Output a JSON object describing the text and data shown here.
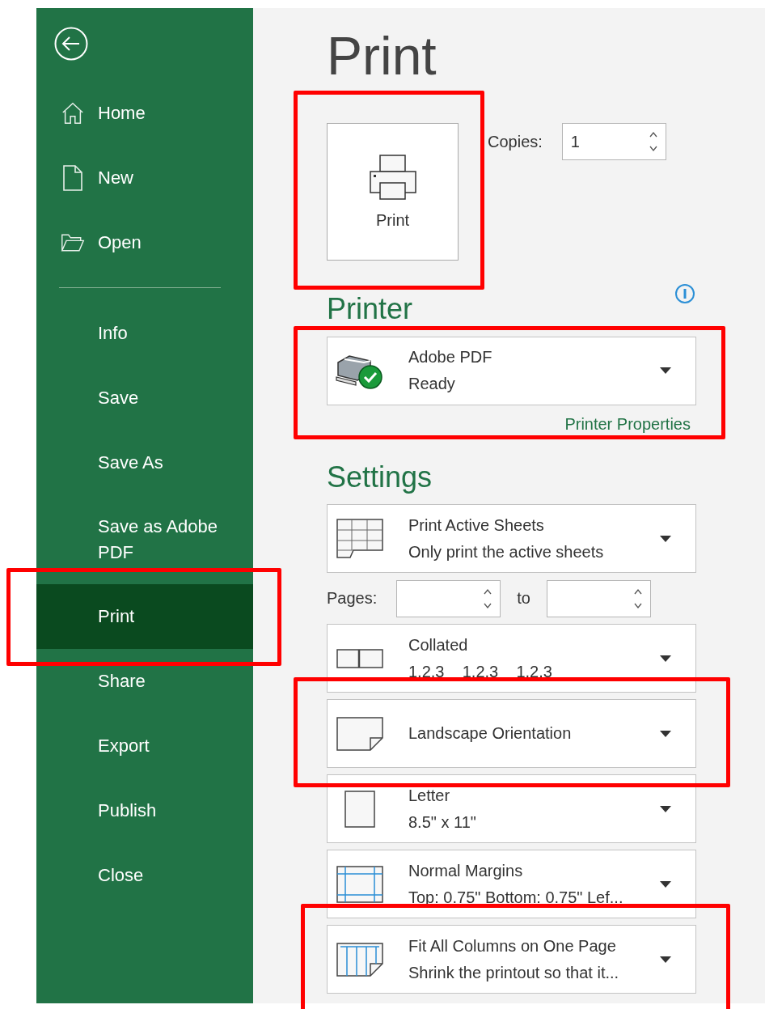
{
  "sidebar": {
    "top_items": [
      {
        "label": "Home",
        "selected": false
      },
      {
        "label": "New",
        "selected": false
      },
      {
        "label": "Open",
        "selected": false
      }
    ],
    "items": [
      {
        "label": "Info",
        "selected": false
      },
      {
        "label": "Save",
        "selected": false
      },
      {
        "label": "Save As",
        "selected": false
      },
      {
        "label": "Save as Adobe PDF",
        "selected": false
      },
      {
        "label": "Print",
        "selected": true
      },
      {
        "label": "Share",
        "selected": false
      },
      {
        "label": "Export",
        "selected": false
      },
      {
        "label": "Publish",
        "selected": false
      },
      {
        "label": "Close",
        "selected": false
      }
    ]
  },
  "title": "Print",
  "print_button": {
    "label": "Print"
  },
  "copies": {
    "label": "Copies:",
    "value": "1"
  },
  "printer": {
    "heading": "Printer",
    "name": "Adobe PDF",
    "status": "Ready",
    "properties_link": "Printer Properties"
  },
  "settings": {
    "heading": "Settings",
    "items": [
      {
        "kind": "dropdown",
        "title": "Print Active Sheets",
        "subtitle": "Only print the active sheets"
      },
      {
        "kind": "pages",
        "label": "Pages:",
        "to": "to"
      },
      {
        "kind": "dropdown",
        "title": "Collated",
        "subtitle": "1,2,3    1,2,3    1,2,3"
      },
      {
        "kind": "dropdown",
        "title": "Landscape Orientation"
      },
      {
        "kind": "dropdown",
        "title": "Letter",
        "subtitle": "8.5\" x 11\""
      },
      {
        "kind": "dropdown",
        "title": "Normal Margins",
        "subtitle": "Top: 0.75\" Bottom: 0.75\" Lef..."
      },
      {
        "kind": "dropdown",
        "title": "Fit All Columns on One Page",
        "subtitle": "Shrink the printout so that it..."
      }
    ]
  }
}
